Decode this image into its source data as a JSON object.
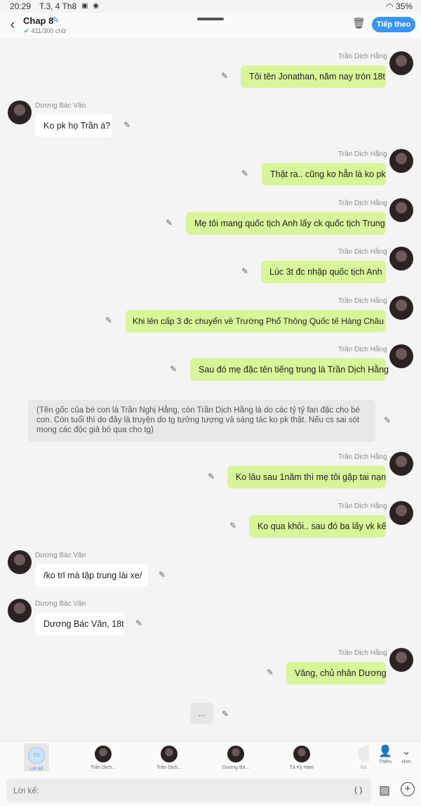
{
  "status": {
    "time": "20:29",
    "date": "T.3, 4 Th8",
    "battery": "35%"
  },
  "header": {
    "title": "Chap 8",
    "word_count": "411/300 chữ",
    "next_label": "Tiếp theo"
  },
  "messages": [
    {
      "sender": "Trần Dịch Hằng",
      "text": "Tôi tên Jonathan, năm nay tròn 18t"
    },
    {
      "sender": "Dương Bác Văn",
      "text": "Ko pk họ Trần à?"
    },
    {
      "sender": "Trần Dịch Hằng",
      "text": "Thật ra.. cũng ko hẳn là ko pk"
    },
    {
      "sender": "Trần Dịch Hằng",
      "text": "Mẹ tôi mang quốc tịch Anh lấy ck quốc tịch Trung"
    },
    {
      "sender": "Trần Dịch Hằng",
      "text": "Lúc 3t đc nhập quốc tịch Anh"
    },
    {
      "sender": "Trần Dịch Hằng",
      "text": "Khi lên cấp 3 đc chuyển về Trường Phổ Thông Quốc tế Hàng Châu"
    },
    {
      "sender": "Trần Dịch Hằng",
      "text": "Sau đó mẹ đặc tên tiếng trung là Trần Dịch Hằng"
    },
    {
      "sender": "",
      "text": "(Tên gốc của bé con là Trần Nghị Hằng, còn Trần Dịch Hằng là do các tỷ tỷ fan đặc cho bé con. Còn tuổi thì do đây là truyện do tg tưởng tượng và sáng tác ko pk thật. Nếu cs sai sót mong các độc giả bỏ qua cho tg)"
    },
    {
      "sender": "Trần Dịch Hằng",
      "text": "Ko lâu sau 1năm thì mẹ tôi gặp tai nạn"
    },
    {
      "sender": "Trần Dịch Hằng",
      "text": "Ko qua khỏi.. sau đó ba lấy vk kế"
    },
    {
      "sender": "Dương Bác Văn",
      "text": "/ko trl mà tập trung lái xe/"
    },
    {
      "sender": "Dương Bác Văn",
      "text": "Dương Bác Văn, 18t"
    },
    {
      "sender": "Trần Dịch Hằng",
      "text": "Vâng, chủ nhân Dương"
    },
    {
      "sender": "",
      "text": "..."
    }
  ],
  "characters": [
    {
      "name": "Lời kể"
    },
    {
      "name": "Trần Dịch..."
    },
    {
      "name": "Trần Dịch..."
    },
    {
      "name": "Dương Bá..."
    },
    {
      "name": "Tả Kỳ Hàm"
    },
    {
      "name": "Bá"
    }
  ],
  "actions": {
    "add_label": "Thêm",
    "more_label": "Hơn"
  },
  "input": {
    "placeholder": "Lời kể:",
    "paren": "( )"
  }
}
